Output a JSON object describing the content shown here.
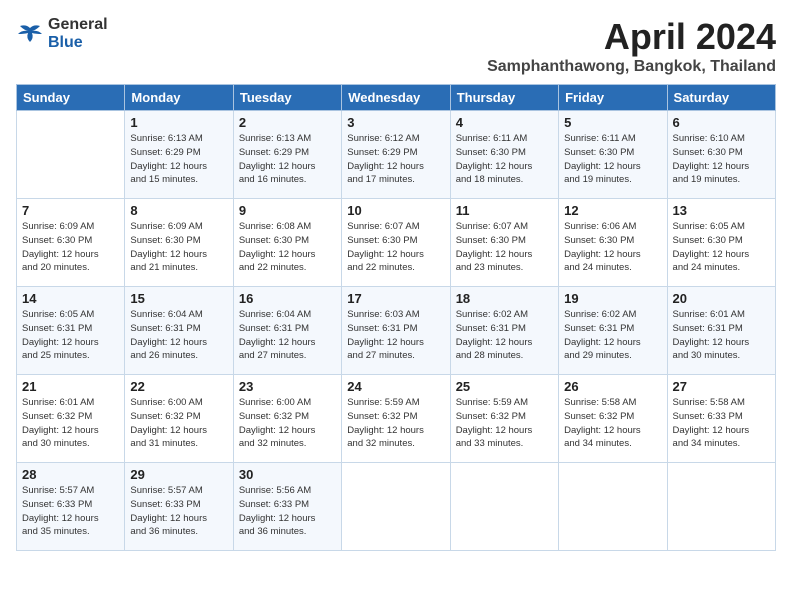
{
  "logo": {
    "general": "General",
    "blue": "Blue"
  },
  "title": "April 2024",
  "location": "Samphanthawong, Bangkok, Thailand",
  "weekdays": [
    "Sunday",
    "Monday",
    "Tuesday",
    "Wednesday",
    "Thursday",
    "Friday",
    "Saturday"
  ],
  "weeks": [
    [
      {
        "day": "",
        "info": ""
      },
      {
        "day": "1",
        "info": "Sunrise: 6:13 AM\nSunset: 6:29 PM\nDaylight: 12 hours\nand 15 minutes."
      },
      {
        "day": "2",
        "info": "Sunrise: 6:13 AM\nSunset: 6:29 PM\nDaylight: 12 hours\nand 16 minutes."
      },
      {
        "day": "3",
        "info": "Sunrise: 6:12 AM\nSunset: 6:29 PM\nDaylight: 12 hours\nand 17 minutes."
      },
      {
        "day": "4",
        "info": "Sunrise: 6:11 AM\nSunset: 6:30 PM\nDaylight: 12 hours\nand 18 minutes."
      },
      {
        "day": "5",
        "info": "Sunrise: 6:11 AM\nSunset: 6:30 PM\nDaylight: 12 hours\nand 19 minutes."
      },
      {
        "day": "6",
        "info": "Sunrise: 6:10 AM\nSunset: 6:30 PM\nDaylight: 12 hours\nand 19 minutes."
      }
    ],
    [
      {
        "day": "7",
        "info": "Sunrise: 6:09 AM\nSunset: 6:30 PM\nDaylight: 12 hours\nand 20 minutes."
      },
      {
        "day": "8",
        "info": "Sunrise: 6:09 AM\nSunset: 6:30 PM\nDaylight: 12 hours\nand 21 minutes."
      },
      {
        "day": "9",
        "info": "Sunrise: 6:08 AM\nSunset: 6:30 PM\nDaylight: 12 hours\nand 22 minutes."
      },
      {
        "day": "10",
        "info": "Sunrise: 6:07 AM\nSunset: 6:30 PM\nDaylight: 12 hours\nand 22 minutes."
      },
      {
        "day": "11",
        "info": "Sunrise: 6:07 AM\nSunset: 6:30 PM\nDaylight: 12 hours\nand 23 minutes."
      },
      {
        "day": "12",
        "info": "Sunrise: 6:06 AM\nSunset: 6:30 PM\nDaylight: 12 hours\nand 24 minutes."
      },
      {
        "day": "13",
        "info": "Sunrise: 6:05 AM\nSunset: 6:30 PM\nDaylight: 12 hours\nand 24 minutes."
      }
    ],
    [
      {
        "day": "14",
        "info": "Sunrise: 6:05 AM\nSunset: 6:31 PM\nDaylight: 12 hours\nand 25 minutes."
      },
      {
        "day": "15",
        "info": "Sunrise: 6:04 AM\nSunset: 6:31 PM\nDaylight: 12 hours\nand 26 minutes."
      },
      {
        "day": "16",
        "info": "Sunrise: 6:04 AM\nSunset: 6:31 PM\nDaylight: 12 hours\nand 27 minutes."
      },
      {
        "day": "17",
        "info": "Sunrise: 6:03 AM\nSunset: 6:31 PM\nDaylight: 12 hours\nand 27 minutes."
      },
      {
        "day": "18",
        "info": "Sunrise: 6:02 AM\nSunset: 6:31 PM\nDaylight: 12 hours\nand 28 minutes."
      },
      {
        "day": "19",
        "info": "Sunrise: 6:02 AM\nSunset: 6:31 PM\nDaylight: 12 hours\nand 29 minutes."
      },
      {
        "day": "20",
        "info": "Sunrise: 6:01 AM\nSunset: 6:31 PM\nDaylight: 12 hours\nand 30 minutes."
      }
    ],
    [
      {
        "day": "21",
        "info": "Sunrise: 6:01 AM\nSunset: 6:32 PM\nDaylight: 12 hours\nand 30 minutes."
      },
      {
        "day": "22",
        "info": "Sunrise: 6:00 AM\nSunset: 6:32 PM\nDaylight: 12 hours\nand 31 minutes."
      },
      {
        "day": "23",
        "info": "Sunrise: 6:00 AM\nSunset: 6:32 PM\nDaylight: 12 hours\nand 32 minutes."
      },
      {
        "day": "24",
        "info": "Sunrise: 5:59 AM\nSunset: 6:32 PM\nDaylight: 12 hours\nand 32 minutes."
      },
      {
        "day": "25",
        "info": "Sunrise: 5:59 AM\nSunset: 6:32 PM\nDaylight: 12 hours\nand 33 minutes."
      },
      {
        "day": "26",
        "info": "Sunrise: 5:58 AM\nSunset: 6:32 PM\nDaylight: 12 hours\nand 34 minutes."
      },
      {
        "day": "27",
        "info": "Sunrise: 5:58 AM\nSunset: 6:33 PM\nDaylight: 12 hours\nand 34 minutes."
      }
    ],
    [
      {
        "day": "28",
        "info": "Sunrise: 5:57 AM\nSunset: 6:33 PM\nDaylight: 12 hours\nand 35 minutes."
      },
      {
        "day": "29",
        "info": "Sunrise: 5:57 AM\nSunset: 6:33 PM\nDaylight: 12 hours\nand 36 minutes."
      },
      {
        "day": "30",
        "info": "Sunrise: 5:56 AM\nSunset: 6:33 PM\nDaylight: 12 hours\nand 36 minutes."
      },
      {
        "day": "",
        "info": ""
      },
      {
        "day": "",
        "info": ""
      },
      {
        "day": "",
        "info": ""
      },
      {
        "day": "",
        "info": ""
      }
    ]
  ]
}
